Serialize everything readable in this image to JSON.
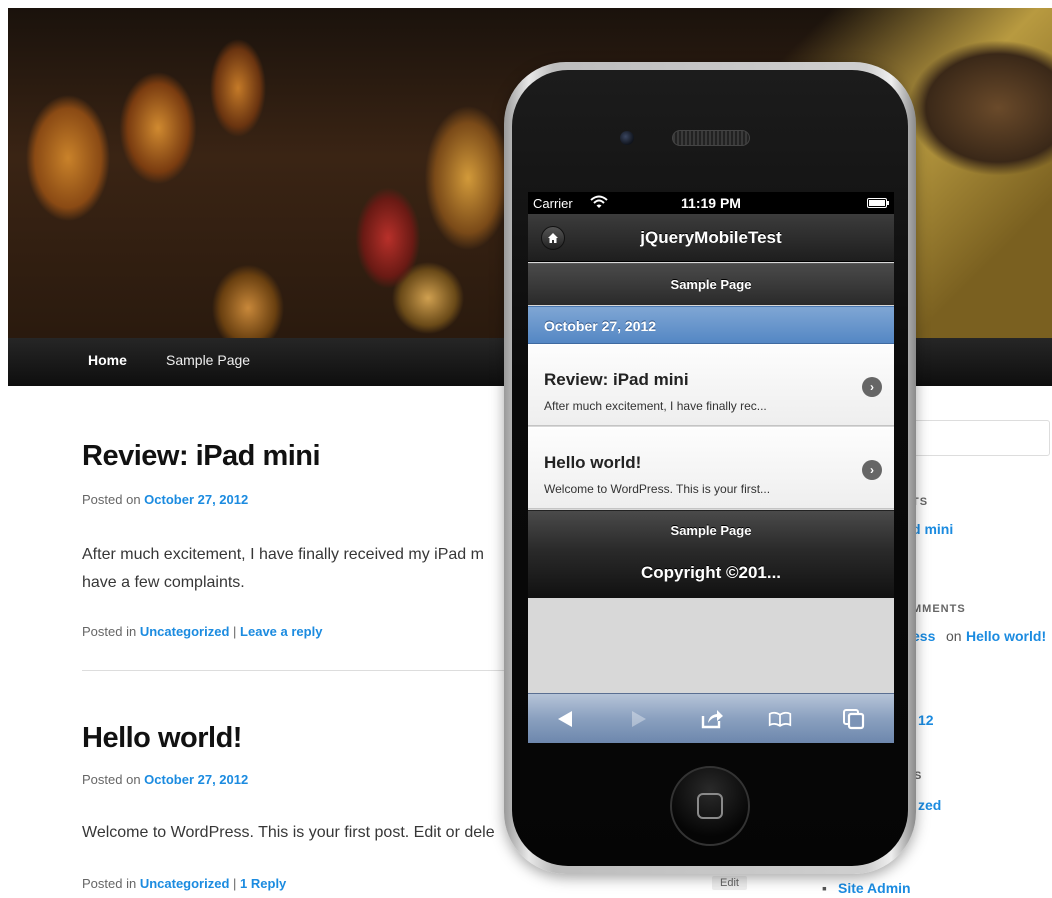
{
  "site": {
    "nav": {
      "home": "Home",
      "sample_page": "Sample Page"
    },
    "posts": [
      {
        "title": "Review: iPad mini",
        "posted_on_label": "Posted on",
        "date": "October 27, 2012",
        "body_line1": "After much excitement,  I have finally received my iPad m",
        "body_line2": "have a few complaints.",
        "posted_in_label": "Posted in",
        "category": "Uncategorized",
        "separator": "|",
        "comments_link": "Leave a reply"
      },
      {
        "title": "Hello world!",
        "posted_on_label": "Posted on",
        "date": "October 27, 2012",
        "body_line1": "Welcome to WordPress. This is your first post. Edit or dele",
        "posted_in_label": "Posted in",
        "category": "Uncategorized",
        "separator": "|",
        "comments_link": "1 Reply",
        "edit_label": "Edit"
      }
    ],
    "sidebar": {
      "recent_posts_head": "TS",
      "recent_post_1": "d mini",
      "recent_post_2": "!",
      "recent_comments_head": "MMENTS",
      "comment_author": "ess",
      "comment_on": "on",
      "comment_post": "Hello world!",
      "archive_item": "12",
      "categories_head": "S",
      "category_item": "zed",
      "meta_bullet": "▪",
      "meta_item": "Site Admin"
    }
  },
  "phone": {
    "status": {
      "carrier": "Carrier",
      "time": "11:19 PM"
    },
    "header_title": "jQueryMobileTest",
    "home_icon": "home-icon",
    "nav_label": "Sample Page",
    "divider_date": "October 27, 2012",
    "items": [
      {
        "title": "Review: iPad mini",
        "desc": "After much excitement,  I have finally rec..."
      },
      {
        "title": "Hello world!",
        "desc": "Welcome to WordPress. This is your first..."
      }
    ],
    "footer_nav": "Sample Page",
    "footer_copyright": "Copyright ©201..."
  },
  "colors": {
    "link_blue": "#1b8be0",
    "jqm_divider_blue": "#5487c4",
    "safari_toolbar": "#8aa0bf"
  }
}
